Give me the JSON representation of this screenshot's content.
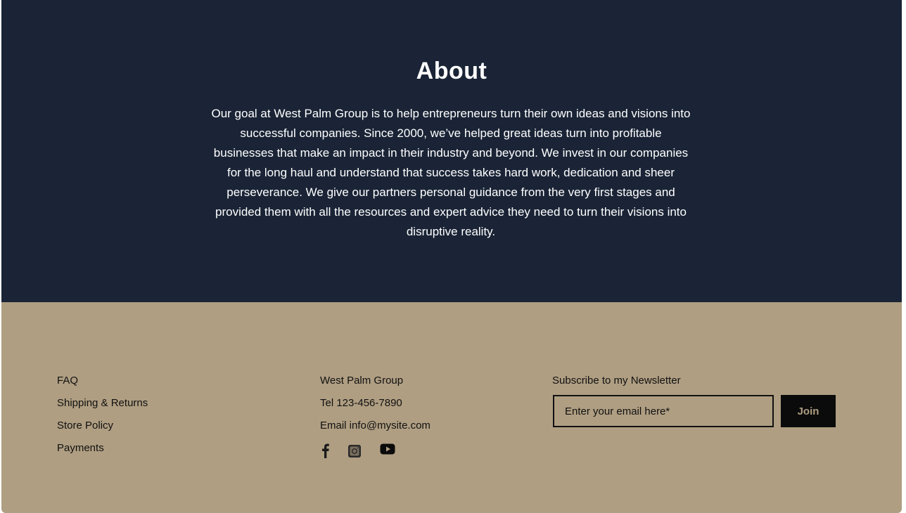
{
  "about": {
    "title": "About",
    "body": "Our goal at West Palm Group is to help entrepreneurs turn their own ideas and visions into successful companies. Since 2000, we’ve helped great ideas turn into profitable businesses that make an impact in their industry and beyond. We invest in our companies for the long haul and understand that success takes hard work, dedication and sheer perseverance. We give our partners personal guidance from the very first stages and provided them with all the resources and expert advice they need to turn their visions into disruptive reality."
  },
  "footer": {
    "links": [
      "FAQ",
      "Shipping & Returns",
      "Store Policy",
      "Payments"
    ],
    "company": "West Palm Group",
    "phone": "Tel 123-456-7890",
    "email": "Email info@mysite.com",
    "social_icons": [
      "facebook-icon",
      "instagram-icon",
      "youtube-icon"
    ],
    "newsletter": {
      "title": "Subscribe to my Newsletter",
      "placeholder": "Enter your email here*",
      "button_label": "Join"
    }
  },
  "colors": {
    "about_bg": "#1a2436",
    "footer_bg": "#af9e82",
    "text_dark": "#111111",
    "button_bg": "#0b0b0b"
  }
}
